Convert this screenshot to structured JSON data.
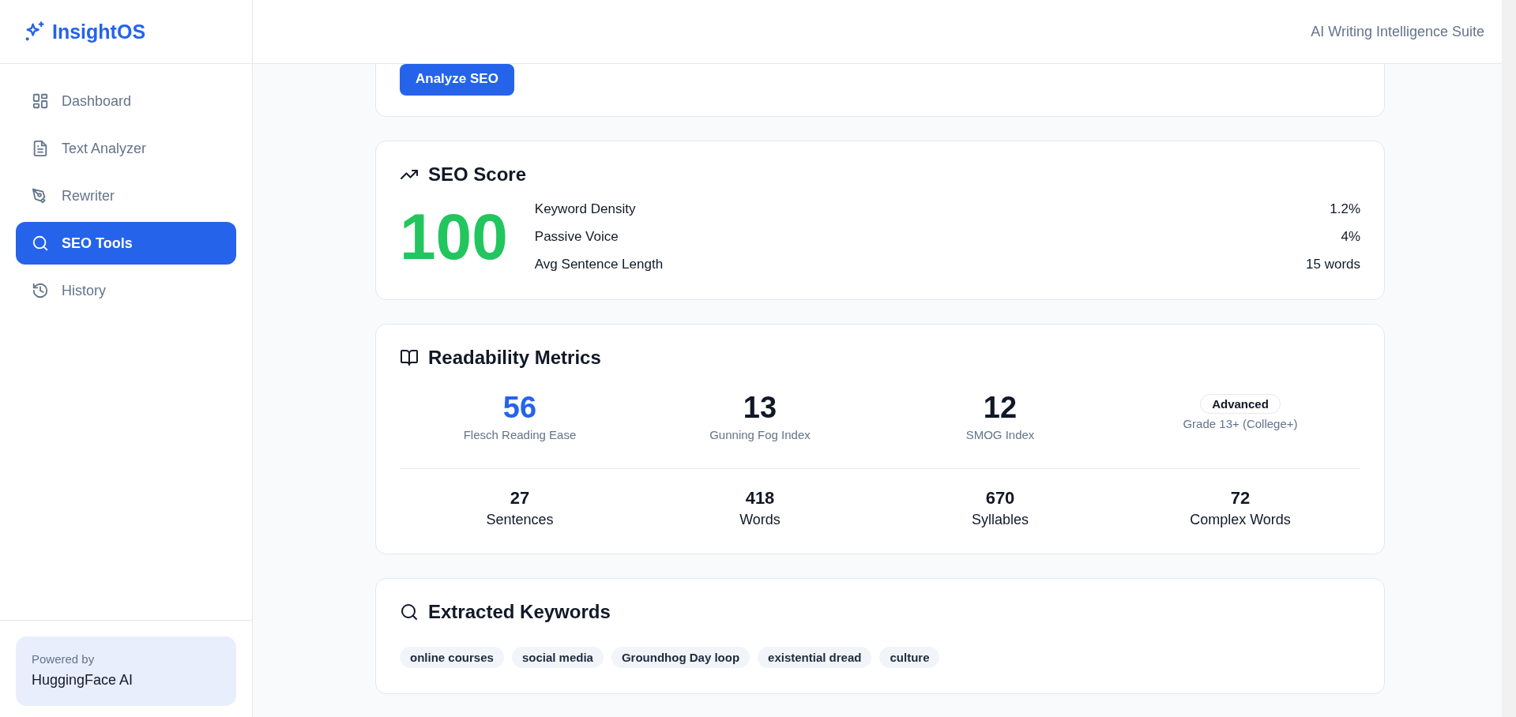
{
  "sidebar": {
    "logo": "InsightOS",
    "items": [
      {
        "label": "Dashboard",
        "selected": false
      },
      {
        "label": "Text Analyzer",
        "selected": false
      },
      {
        "label": "Rewriter",
        "selected": false
      },
      {
        "label": "SEO Tools",
        "selected": true
      },
      {
        "label": "History",
        "selected": false
      }
    ],
    "footer": {
      "caption": "Powered by",
      "name": "HuggingFace AI"
    }
  },
  "header": {
    "subtitle": "AI Writing Intelligence Suite"
  },
  "analyze_button": "Analyze SEO",
  "seo_score": {
    "title": "SEO Score",
    "score": "100",
    "metrics": [
      {
        "label": "Keyword Density",
        "value": "1.2%"
      },
      {
        "label": "Passive Voice",
        "value": "4%"
      },
      {
        "label": "Avg Sentence Length",
        "value": "15 words"
      }
    ]
  },
  "readability": {
    "title": "Readability Metrics",
    "scores": [
      {
        "value": "56",
        "label": "Flesch Reading Ease",
        "highlight": true
      },
      {
        "value": "13",
        "label": "Gunning Fog Index",
        "highlight": false
      },
      {
        "value": "12",
        "label": "SMOG Index",
        "highlight": false
      }
    ],
    "level": {
      "badge": "Advanced",
      "label": "Grade 13+ (College+)"
    },
    "counts": [
      {
        "value": "27",
        "label": "Sentences"
      },
      {
        "value": "418",
        "label": "Words"
      },
      {
        "value": "670",
        "label": "Syllables"
      },
      {
        "value": "72",
        "label": "Complex Words"
      }
    ]
  },
  "keywords": {
    "title": "Extracted Keywords",
    "items": [
      "online courses",
      "social media",
      "Groundhog Day loop",
      "existential dread",
      "culture"
    ]
  }
}
